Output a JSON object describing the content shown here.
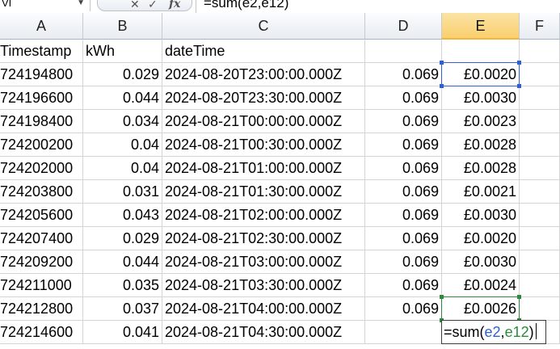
{
  "formula_bar": {
    "name_box": "VI",
    "formula": "=sum(e2,e12)",
    "cancel_icon": "x-icon",
    "enter_icon": "check-icon",
    "insert_function_label": "fx"
  },
  "columns": [
    "A",
    "B",
    "C",
    "D",
    "E",
    "F"
  ],
  "selected_column": "E",
  "header_row": {
    "a": "Timestamp",
    "b": "kWh",
    "c": "dateTime",
    "d": "",
    "e": ""
  },
  "rows": [
    {
      "a": "724194800",
      "b": "0.029",
      "c": "2024-08-20T23:00:00.000Z",
      "d": "0.069",
      "e": "£0.0020"
    },
    {
      "a": "724196600",
      "b": "0.044",
      "c": "2024-08-20T23:30:00.000Z",
      "d": "0.069",
      "e": "£0.0030"
    },
    {
      "a": "724198400",
      "b": "0.034",
      "c": "2024-08-21T00:00:00.000Z",
      "d": "0.069",
      "e": "£0.0023"
    },
    {
      "a": "724200200",
      "b": "0.04",
      "c": "2024-08-21T00:30:00.000Z",
      "d": "0.069",
      "e": "£0.0028"
    },
    {
      "a": "724202000",
      "b": "0.04",
      "c": "2024-08-21T01:00:00.000Z",
      "d": "0.069",
      "e": "£0.0028"
    },
    {
      "a": "724203800",
      "b": "0.031",
      "c": "2024-08-21T01:30:00.000Z",
      "d": "0.069",
      "e": "£0.0021"
    },
    {
      "a": "724205600",
      "b": "0.043",
      "c": "2024-08-21T02:00:00.000Z",
      "d": "0.069",
      "e": "£0.0030"
    },
    {
      "a": "724207400",
      "b": "0.029",
      "c": "2024-08-21T02:30:00.000Z",
      "d": "0.069",
      "e": "£0.0020"
    },
    {
      "a": "724209200",
      "b": "0.044",
      "c": "2024-08-21T03:00:00.000Z",
      "d": "0.069",
      "e": "£0.0030"
    },
    {
      "a": "724211000",
      "b": "0.035",
      "c": "2024-08-21T03:30:00.000Z",
      "d": "0.069",
      "e": "£0.0024"
    },
    {
      "a": "724212800",
      "b": "0.037",
      "c": "2024-08-21T04:00:00.000Z",
      "d": "0.069",
      "e": "£0.0026"
    },
    {
      "a": "724214600",
      "b": "0.041",
      "c": "2024-08-21T04:30:00.000Z",
      "d": "",
      "e": ""
    }
  ],
  "cell_editor": {
    "prefix": "=sum(",
    "ref1": "e2",
    "sep": ",",
    "ref2": "e12",
    "suffix": ")"
  },
  "colors": {
    "ref1": "#2f5fd6",
    "ref2": "#2c8a3a",
    "selected_header": "#f9cf6e"
  }
}
